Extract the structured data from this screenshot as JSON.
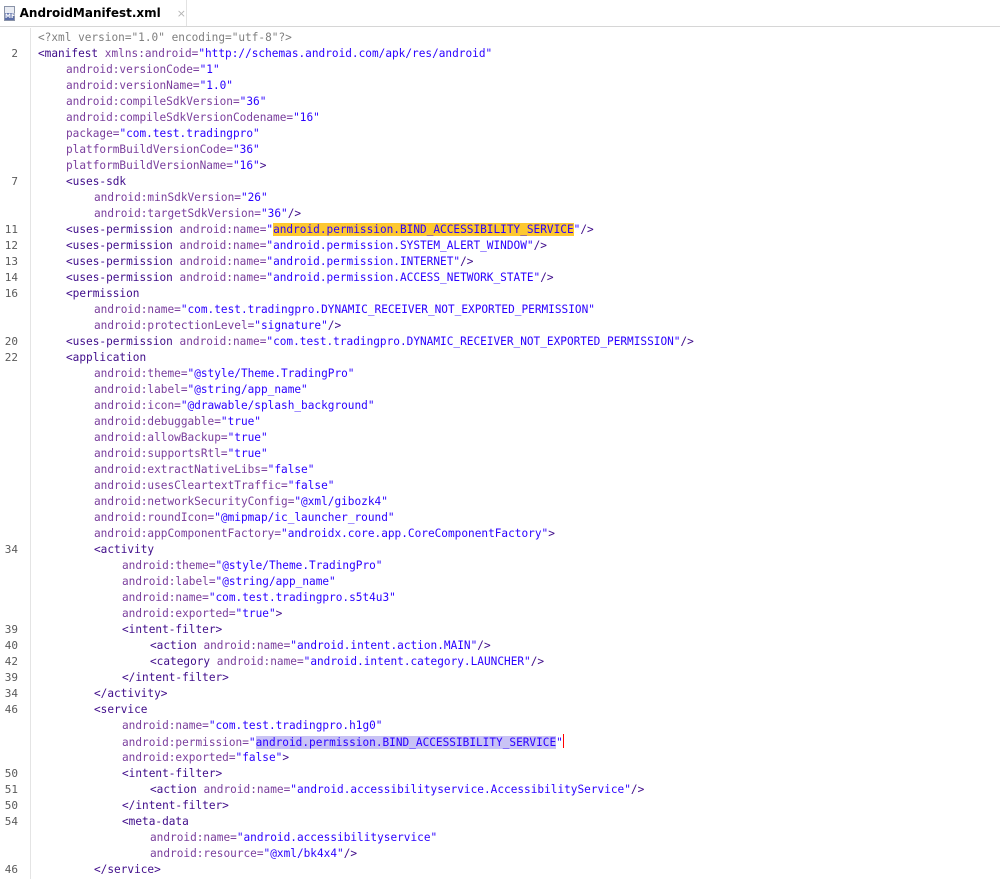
{
  "tab": {
    "title": "AndroidManifest.xml",
    "icon_label": "MF",
    "close": "×"
  },
  "colors": {
    "yellow_highlight": "#fdc830",
    "lilac_highlight": "#c9c3f5"
  },
  "lines": [
    {
      "n": "",
      "indent": 0,
      "segs": [
        {
          "t": "<?xml version=\"1.0\" encoding=\"utf-8\"?>",
          "c": "pi"
        }
      ]
    },
    {
      "n": "2",
      "indent": 0,
      "segs": [
        {
          "t": "<manifest",
          "c": "tag"
        },
        {
          "t": " xmlns:android=",
          "c": "attr"
        },
        {
          "t": "\"http://schemas.android.com/apk/res/android\"",
          "c": "val"
        }
      ]
    },
    {
      "n": "",
      "indent": 1,
      "segs": [
        {
          "t": "android:versionCode=",
          "c": "attr"
        },
        {
          "t": "\"1\"",
          "c": "val"
        }
      ]
    },
    {
      "n": "",
      "indent": 1,
      "segs": [
        {
          "t": "android:versionName=",
          "c": "attr"
        },
        {
          "t": "\"1.0\"",
          "c": "val"
        }
      ]
    },
    {
      "n": "",
      "indent": 1,
      "segs": [
        {
          "t": "android:compileSdkVersion=",
          "c": "attr"
        },
        {
          "t": "\"36\"",
          "c": "val"
        }
      ]
    },
    {
      "n": "",
      "indent": 1,
      "segs": [
        {
          "t": "android:compileSdkVersionCodename=",
          "c": "attr"
        },
        {
          "t": "\"16\"",
          "c": "val"
        }
      ]
    },
    {
      "n": "",
      "indent": 1,
      "segs": [
        {
          "t": "package=",
          "c": "attr"
        },
        {
          "t": "\"com.test.tradingpro\"",
          "c": "val"
        }
      ]
    },
    {
      "n": "",
      "indent": 1,
      "segs": [
        {
          "t": "platformBuildVersionCode=",
          "c": "attr"
        },
        {
          "t": "\"36\"",
          "c": "val"
        }
      ]
    },
    {
      "n": "",
      "indent": 1,
      "segs": [
        {
          "t": "platformBuildVersionName=",
          "c": "attr"
        },
        {
          "t": "\"16\"",
          "c": "val"
        },
        {
          "t": ">",
          "c": "tag"
        }
      ]
    },
    {
      "n": "7",
      "indent": 1,
      "segs": [
        {
          "t": "<uses-sdk",
          "c": "tag"
        }
      ]
    },
    {
      "n": "",
      "indent": 2,
      "segs": [
        {
          "t": "android:minSdkVersion=",
          "c": "attr"
        },
        {
          "t": "\"26\"",
          "c": "val"
        }
      ]
    },
    {
      "n": "",
      "indent": 2,
      "segs": [
        {
          "t": "android:targetSdkVersion=",
          "c": "attr"
        },
        {
          "t": "\"36\"",
          "c": "val"
        },
        {
          "t": "/>",
          "c": "tag"
        }
      ]
    },
    {
      "n": "11",
      "indent": 1,
      "segs": [
        {
          "t": "<uses-permission",
          "c": "tag"
        },
        {
          "t": " android:name=",
          "c": "attr"
        },
        {
          "t": "\"",
          "c": "val"
        },
        {
          "t": "android.permission.BIND_ACCESSIBILITY_SERVICE",
          "c": "val",
          "hl": "yellow"
        },
        {
          "t": "\"",
          "c": "val"
        },
        {
          "t": "/>",
          "c": "tag"
        }
      ]
    },
    {
      "n": "12",
      "indent": 1,
      "segs": [
        {
          "t": "<uses-permission",
          "c": "tag"
        },
        {
          "t": " android:name=",
          "c": "attr"
        },
        {
          "t": "\"android.permission.SYSTEM_ALERT_WINDOW\"",
          "c": "val"
        },
        {
          "t": "/>",
          "c": "tag"
        }
      ]
    },
    {
      "n": "13",
      "indent": 1,
      "segs": [
        {
          "t": "<uses-permission",
          "c": "tag"
        },
        {
          "t": " android:name=",
          "c": "attr"
        },
        {
          "t": "\"android.permission.INTERNET\"",
          "c": "val"
        },
        {
          "t": "/>",
          "c": "tag"
        }
      ]
    },
    {
      "n": "14",
      "indent": 1,
      "segs": [
        {
          "t": "<uses-permission",
          "c": "tag"
        },
        {
          "t": " android:name=",
          "c": "attr"
        },
        {
          "t": "\"android.permission.ACCESS_NETWORK_STATE\"",
          "c": "val"
        },
        {
          "t": "/>",
          "c": "tag"
        }
      ]
    },
    {
      "n": "16",
      "indent": 1,
      "segs": [
        {
          "t": "<permission",
          "c": "tag"
        }
      ]
    },
    {
      "n": "",
      "indent": 2,
      "segs": [
        {
          "t": "android:name=",
          "c": "attr"
        },
        {
          "t": "\"com.test.tradingpro.DYNAMIC_RECEIVER_NOT_EXPORTED_PERMISSION\"",
          "c": "val"
        }
      ]
    },
    {
      "n": "",
      "indent": 2,
      "segs": [
        {
          "t": "android:protectionLevel=",
          "c": "attr"
        },
        {
          "t": "\"signature\"",
          "c": "val"
        },
        {
          "t": "/>",
          "c": "tag"
        }
      ]
    },
    {
      "n": "20",
      "indent": 1,
      "segs": [
        {
          "t": "<uses-permission",
          "c": "tag"
        },
        {
          "t": " android:name=",
          "c": "attr"
        },
        {
          "t": "\"com.test.tradingpro.DYNAMIC_RECEIVER_NOT_EXPORTED_PERMISSION\"",
          "c": "val"
        },
        {
          "t": "/>",
          "c": "tag"
        }
      ]
    },
    {
      "n": "22",
      "indent": 1,
      "segs": [
        {
          "t": "<application",
          "c": "tag"
        }
      ]
    },
    {
      "n": "",
      "indent": 2,
      "segs": [
        {
          "t": "android:theme=",
          "c": "attr"
        },
        {
          "t": "\"@style/Theme.TradingPro\"",
          "c": "val"
        }
      ]
    },
    {
      "n": "",
      "indent": 2,
      "segs": [
        {
          "t": "android:label=",
          "c": "attr"
        },
        {
          "t": "\"@string/app_name\"",
          "c": "val"
        }
      ]
    },
    {
      "n": "",
      "indent": 2,
      "segs": [
        {
          "t": "android:icon=",
          "c": "attr"
        },
        {
          "t": "\"@drawable/splash_background\"",
          "c": "val"
        }
      ]
    },
    {
      "n": "",
      "indent": 2,
      "segs": [
        {
          "t": "android:debuggable=",
          "c": "attr"
        },
        {
          "t": "\"true\"",
          "c": "val"
        }
      ]
    },
    {
      "n": "",
      "indent": 2,
      "segs": [
        {
          "t": "android:allowBackup=",
          "c": "attr"
        },
        {
          "t": "\"true\"",
          "c": "val"
        }
      ]
    },
    {
      "n": "",
      "indent": 2,
      "segs": [
        {
          "t": "android:supportsRtl=",
          "c": "attr"
        },
        {
          "t": "\"true\"",
          "c": "val"
        }
      ]
    },
    {
      "n": "",
      "indent": 2,
      "segs": [
        {
          "t": "android:extractNativeLibs=",
          "c": "attr"
        },
        {
          "t": "\"false\"",
          "c": "val"
        }
      ]
    },
    {
      "n": "",
      "indent": 2,
      "segs": [
        {
          "t": "android:usesCleartextTraffic=",
          "c": "attr"
        },
        {
          "t": "\"false\"",
          "c": "val"
        }
      ]
    },
    {
      "n": "",
      "indent": 2,
      "segs": [
        {
          "t": "android:networkSecurityConfig=",
          "c": "attr"
        },
        {
          "t": "\"@xml/gibozk4\"",
          "c": "val"
        }
      ]
    },
    {
      "n": "",
      "indent": 2,
      "segs": [
        {
          "t": "android:roundIcon=",
          "c": "attr"
        },
        {
          "t": "\"@mipmap/ic_launcher_round\"",
          "c": "val"
        }
      ]
    },
    {
      "n": "",
      "indent": 2,
      "segs": [
        {
          "t": "android:appComponentFactory=",
          "c": "attr"
        },
        {
          "t": "\"androidx.core.app.CoreComponentFactory\"",
          "c": "val"
        },
        {
          "t": ">",
          "c": "tag"
        }
      ]
    },
    {
      "n": "34",
      "indent": 2,
      "segs": [
        {
          "t": "<activity",
          "c": "tag"
        }
      ]
    },
    {
      "n": "",
      "indent": 3,
      "segs": [
        {
          "t": "android:theme=",
          "c": "attr"
        },
        {
          "t": "\"@style/Theme.TradingPro\"",
          "c": "val"
        }
      ]
    },
    {
      "n": "",
      "indent": 3,
      "segs": [
        {
          "t": "android:label=",
          "c": "attr"
        },
        {
          "t": "\"@string/app_name\"",
          "c": "val"
        }
      ]
    },
    {
      "n": "",
      "indent": 3,
      "segs": [
        {
          "t": "android:name=",
          "c": "attr"
        },
        {
          "t": "\"com.test.tradingpro.s5t4u3\"",
          "c": "val"
        }
      ]
    },
    {
      "n": "",
      "indent": 3,
      "segs": [
        {
          "t": "android:exported=",
          "c": "attr"
        },
        {
          "t": "\"true\"",
          "c": "val"
        },
        {
          "t": ">",
          "c": "tag"
        }
      ]
    },
    {
      "n": "39",
      "indent": 3,
      "segs": [
        {
          "t": "<intent-filter>",
          "c": "tag"
        }
      ]
    },
    {
      "n": "40",
      "indent": 4,
      "segs": [
        {
          "t": "<action",
          "c": "tag"
        },
        {
          "t": " android:name=",
          "c": "attr"
        },
        {
          "t": "\"android.intent.action.MAIN\"",
          "c": "val"
        },
        {
          "t": "/>",
          "c": "tag"
        }
      ]
    },
    {
      "n": "42",
      "indent": 4,
      "segs": [
        {
          "t": "<category",
          "c": "tag"
        },
        {
          "t": " android:name=",
          "c": "attr"
        },
        {
          "t": "\"android.intent.category.LAUNCHER\"",
          "c": "val"
        },
        {
          "t": "/>",
          "c": "tag"
        }
      ]
    },
    {
      "n": "39",
      "indent": 3,
      "segs": [
        {
          "t": "</intent-filter>",
          "c": "tag"
        }
      ]
    },
    {
      "n": "34",
      "indent": 2,
      "segs": [
        {
          "t": "</activity>",
          "c": "tag"
        }
      ]
    },
    {
      "n": "46",
      "indent": 2,
      "segs": [
        {
          "t": "<service",
          "c": "tag"
        }
      ]
    },
    {
      "n": "",
      "indent": 3,
      "segs": [
        {
          "t": "android:name=",
          "c": "attr"
        },
        {
          "t": "\"com.test.tradingpro.h1g0\"",
          "c": "val"
        }
      ]
    },
    {
      "n": "",
      "indent": 3,
      "segs": [
        {
          "t": "android:permission=",
          "c": "attr"
        },
        {
          "t": "\"",
          "c": "val"
        },
        {
          "t": "android.permission.BIND_ACCESSIBILITY_SERVICE",
          "c": "val",
          "hl": "lilac"
        },
        {
          "t": "\"",
          "c": "val",
          "caret": true
        }
      ]
    },
    {
      "n": "",
      "indent": 3,
      "segs": [
        {
          "t": "android:exported=",
          "c": "attr"
        },
        {
          "t": "\"false\"",
          "c": "val"
        },
        {
          "t": ">",
          "c": "tag"
        }
      ]
    },
    {
      "n": "50",
      "indent": 3,
      "segs": [
        {
          "t": "<intent-filter>",
          "c": "tag"
        }
      ]
    },
    {
      "n": "51",
      "indent": 4,
      "segs": [
        {
          "t": "<action",
          "c": "tag"
        },
        {
          "t": " android:name=",
          "c": "attr"
        },
        {
          "t": "\"android.accessibilityservice.AccessibilityService\"",
          "c": "val"
        },
        {
          "t": "/>",
          "c": "tag"
        }
      ]
    },
    {
      "n": "50",
      "indent": 3,
      "segs": [
        {
          "t": "</intent-filter>",
          "c": "tag"
        }
      ]
    },
    {
      "n": "54",
      "indent": 3,
      "segs": [
        {
          "t": "<meta-data",
          "c": "tag"
        }
      ]
    },
    {
      "n": "",
      "indent": 4,
      "segs": [
        {
          "t": "android:name=",
          "c": "attr"
        },
        {
          "t": "\"android.accessibilityservice\"",
          "c": "val"
        }
      ]
    },
    {
      "n": "",
      "indent": 4,
      "segs": [
        {
          "t": "android:resource=",
          "c": "attr"
        },
        {
          "t": "\"@xml/bk4x4\"",
          "c": "val"
        },
        {
          "t": "/>",
          "c": "tag"
        }
      ]
    },
    {
      "n": "46",
      "indent": 2,
      "segs": [
        {
          "t": "</service>",
          "c": "tag"
        }
      ]
    }
  ]
}
